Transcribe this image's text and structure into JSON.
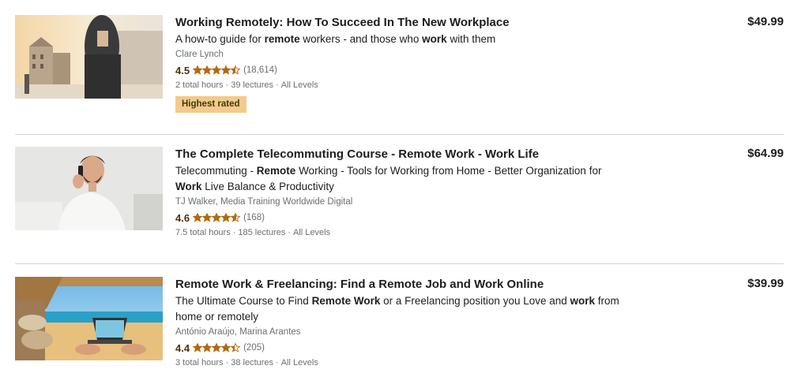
{
  "courses": [
    {
      "title": "Working Remotely: How To Succeed In The New Workplace",
      "headline_parts": [
        {
          "text": "A how-to guide for ",
          "bold": false
        },
        {
          "text": "remote",
          "bold": true
        },
        {
          "text": " workers - and those who ",
          "bold": false
        },
        {
          "text": "work",
          "bold": true
        },
        {
          "text": " with them",
          "bold": false
        }
      ],
      "instructor": "Clare Lynch",
      "rating": "4.5",
      "rating_value": 4.5,
      "reviews": "(18,614)",
      "hours": "2 total hours",
      "lectures": "39 lectures",
      "level": "All Levels",
      "badge": "Highest rated",
      "price": "$49.99",
      "thumbnail_icon": "office-worker-street-image"
    },
    {
      "title": "The Complete Telecommuting Course - Remote Work - Work Life",
      "headline_parts": [
        {
          "text": "Telecommuting - ",
          "bold": false
        },
        {
          "text": "Remote",
          "bold": true
        },
        {
          "text": " Working - Tools for Working from Home - Better Organization for ",
          "bold": false
        },
        {
          "text": "Work",
          "bold": true
        },
        {
          "text": " Live Balance & Productivity",
          "bold": false
        }
      ],
      "instructor": "TJ Walker, Media Training Worldwide Digital",
      "rating": "4.6",
      "rating_value": 4.6,
      "reviews": "(168)",
      "hours": "7.5 total hours",
      "lectures": "185 lectures",
      "level": "All Levels",
      "badge": "",
      "price": "$64.99",
      "thumbnail_icon": "man-on-phone-image"
    },
    {
      "title": "Remote Work & Freelancing: Find a Remote Job and Work Online",
      "headline_parts": [
        {
          "text": "The Ultimate Course to Find ",
          "bold": false
        },
        {
          "text": "Remote Work",
          "bold": true
        },
        {
          "text": " or a Freelancing position you Love and ",
          "bold": false
        },
        {
          "text": "work",
          "bold": true
        },
        {
          "text": " from home or remotely",
          "bold": false
        }
      ],
      "instructor": "António Araújo, Marina Arantes",
      "rating": "4.4",
      "rating_value": 4.4,
      "reviews": "(205)",
      "hours": "3 total hours",
      "lectures": "38 lectures",
      "level": "All Levels",
      "badge": "",
      "price": "$39.99",
      "thumbnail_icon": "beach-laptop-image"
    }
  ],
  "colors": {
    "star": "#b4690e",
    "rating_text": "#4d3105",
    "badge_bg": "#f3ca8c",
    "muted": "#6a6f73",
    "divider": "#d1d7dc"
  }
}
